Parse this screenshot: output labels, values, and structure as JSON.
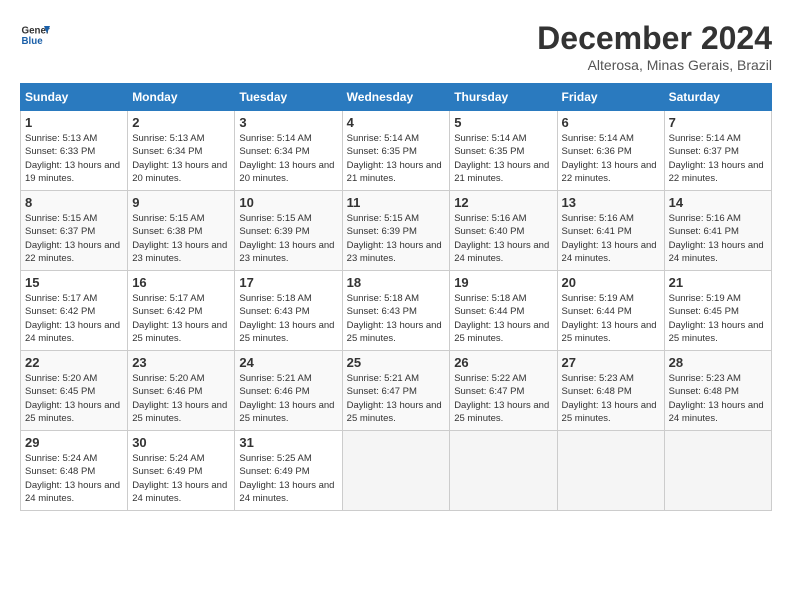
{
  "header": {
    "logo_line1": "General",
    "logo_line2": "Blue",
    "month": "December 2024",
    "location": "Alterosa, Minas Gerais, Brazil"
  },
  "weekdays": [
    "Sunday",
    "Monday",
    "Tuesday",
    "Wednesday",
    "Thursday",
    "Friday",
    "Saturday"
  ],
  "weeks": [
    [
      {
        "day": "1",
        "sunrise": "5:13 AM",
        "sunset": "6:33 PM",
        "daylight": "13 hours and 19 minutes."
      },
      {
        "day": "2",
        "sunrise": "5:13 AM",
        "sunset": "6:34 PM",
        "daylight": "13 hours and 20 minutes."
      },
      {
        "day": "3",
        "sunrise": "5:14 AM",
        "sunset": "6:34 PM",
        "daylight": "13 hours and 20 minutes."
      },
      {
        "day": "4",
        "sunrise": "5:14 AM",
        "sunset": "6:35 PM",
        "daylight": "13 hours and 21 minutes."
      },
      {
        "day": "5",
        "sunrise": "5:14 AM",
        "sunset": "6:35 PM",
        "daylight": "13 hours and 21 minutes."
      },
      {
        "day": "6",
        "sunrise": "5:14 AM",
        "sunset": "6:36 PM",
        "daylight": "13 hours and 22 minutes."
      },
      {
        "day": "7",
        "sunrise": "5:14 AM",
        "sunset": "6:37 PM",
        "daylight": "13 hours and 22 minutes."
      }
    ],
    [
      {
        "day": "8",
        "sunrise": "5:15 AM",
        "sunset": "6:37 PM",
        "daylight": "13 hours and 22 minutes."
      },
      {
        "day": "9",
        "sunrise": "5:15 AM",
        "sunset": "6:38 PM",
        "daylight": "13 hours and 23 minutes."
      },
      {
        "day": "10",
        "sunrise": "5:15 AM",
        "sunset": "6:39 PM",
        "daylight": "13 hours and 23 minutes."
      },
      {
        "day": "11",
        "sunrise": "5:15 AM",
        "sunset": "6:39 PM",
        "daylight": "13 hours and 23 minutes."
      },
      {
        "day": "12",
        "sunrise": "5:16 AM",
        "sunset": "6:40 PM",
        "daylight": "13 hours and 24 minutes."
      },
      {
        "day": "13",
        "sunrise": "5:16 AM",
        "sunset": "6:41 PM",
        "daylight": "13 hours and 24 minutes."
      },
      {
        "day": "14",
        "sunrise": "5:16 AM",
        "sunset": "6:41 PM",
        "daylight": "13 hours and 24 minutes."
      }
    ],
    [
      {
        "day": "15",
        "sunrise": "5:17 AM",
        "sunset": "6:42 PM",
        "daylight": "13 hours and 24 minutes."
      },
      {
        "day": "16",
        "sunrise": "5:17 AM",
        "sunset": "6:42 PM",
        "daylight": "13 hours and 25 minutes."
      },
      {
        "day": "17",
        "sunrise": "5:18 AM",
        "sunset": "6:43 PM",
        "daylight": "13 hours and 25 minutes."
      },
      {
        "day": "18",
        "sunrise": "5:18 AM",
        "sunset": "6:43 PM",
        "daylight": "13 hours and 25 minutes."
      },
      {
        "day": "19",
        "sunrise": "5:18 AM",
        "sunset": "6:44 PM",
        "daylight": "13 hours and 25 minutes."
      },
      {
        "day": "20",
        "sunrise": "5:19 AM",
        "sunset": "6:44 PM",
        "daylight": "13 hours and 25 minutes."
      },
      {
        "day": "21",
        "sunrise": "5:19 AM",
        "sunset": "6:45 PM",
        "daylight": "13 hours and 25 minutes."
      }
    ],
    [
      {
        "day": "22",
        "sunrise": "5:20 AM",
        "sunset": "6:45 PM",
        "daylight": "13 hours and 25 minutes."
      },
      {
        "day": "23",
        "sunrise": "5:20 AM",
        "sunset": "6:46 PM",
        "daylight": "13 hours and 25 minutes."
      },
      {
        "day": "24",
        "sunrise": "5:21 AM",
        "sunset": "6:46 PM",
        "daylight": "13 hours and 25 minutes."
      },
      {
        "day": "25",
        "sunrise": "5:21 AM",
        "sunset": "6:47 PM",
        "daylight": "13 hours and 25 minutes."
      },
      {
        "day": "26",
        "sunrise": "5:22 AM",
        "sunset": "6:47 PM",
        "daylight": "13 hours and 25 minutes."
      },
      {
        "day": "27",
        "sunrise": "5:23 AM",
        "sunset": "6:48 PM",
        "daylight": "13 hours and 25 minutes."
      },
      {
        "day": "28",
        "sunrise": "5:23 AM",
        "sunset": "6:48 PM",
        "daylight": "13 hours and 24 minutes."
      }
    ],
    [
      {
        "day": "29",
        "sunrise": "5:24 AM",
        "sunset": "6:48 PM",
        "daylight": "13 hours and 24 minutes."
      },
      {
        "day": "30",
        "sunrise": "5:24 AM",
        "sunset": "6:49 PM",
        "daylight": "13 hours and 24 minutes."
      },
      {
        "day": "31",
        "sunrise": "5:25 AM",
        "sunset": "6:49 PM",
        "daylight": "13 hours and 24 minutes."
      },
      null,
      null,
      null,
      null
    ]
  ]
}
